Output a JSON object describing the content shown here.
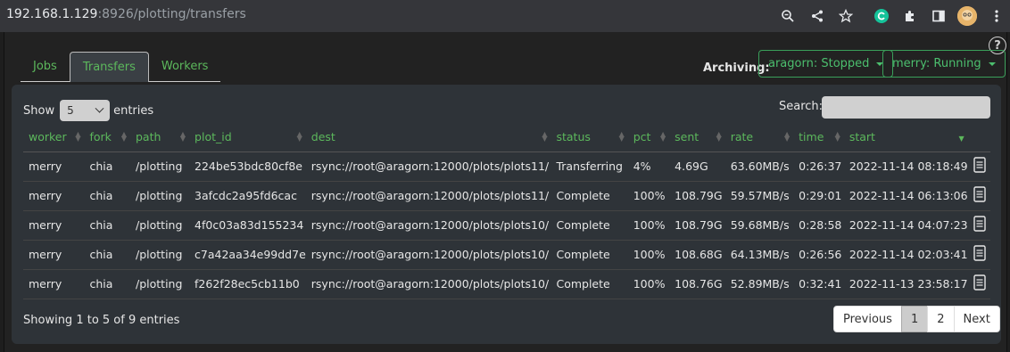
{
  "browser": {
    "url_host": "192.168.1.129",
    "url_rest": ":8926/plotting/transfers"
  },
  "tabs": [
    {
      "label": "Jobs",
      "active": false
    },
    {
      "label": "Transfers",
      "active": true
    },
    {
      "label": "Workers",
      "active": false
    }
  ],
  "archiving": {
    "label": "Archiving:",
    "buttons": [
      {
        "label": "aragorn: Stopped"
      },
      {
        "label": "merry: Running"
      }
    ]
  },
  "help_icon": "?",
  "length": {
    "show": "Show",
    "value": "5",
    "entries": "entries"
  },
  "search": {
    "label": "Search:"
  },
  "table": {
    "columns": [
      "worker",
      "fork",
      "path",
      "plot_id",
      "dest",
      "status",
      "pct",
      "sent",
      "rate",
      "time",
      "start"
    ],
    "rows": [
      [
        "merry",
        "chia",
        "/plotting",
        "224be53bdc80cf8e",
        "rsync://root@aragorn:12000/plots/plots11/",
        "Transferring",
        "4%",
        "4.69G",
        "63.60MB/s",
        "0:26:37",
        "2022-11-14 08:18:49"
      ],
      [
        "merry",
        "chia",
        "/plotting",
        "3afcdc2a95fd6cac",
        "rsync://root@aragorn:12000/plots/plots11/",
        "Complete",
        "100%",
        "108.79G",
        "59.57MB/s",
        "0:29:01",
        "2022-11-14 06:13:06"
      ],
      [
        "merry",
        "chia",
        "/plotting",
        "4f0c03a83d155234",
        "rsync://root@aragorn:12000/plots/plots10/",
        "Complete",
        "100%",
        "108.79G",
        "59.68MB/s",
        "0:28:58",
        "2022-11-14 04:07:23"
      ],
      [
        "merry",
        "chia",
        "/plotting",
        "c7a42aa34e99dd7e",
        "rsync://root@aragorn:12000/plots/plots10/",
        "Complete",
        "100%",
        "108.68G",
        "64.13MB/s",
        "0:26:56",
        "2022-11-14 02:03:41"
      ],
      [
        "merry",
        "chia",
        "/plotting",
        "f262f28ec5cb11b0",
        "rsync://root@aragorn:12000/plots/plots10/",
        "Complete",
        "100%",
        "108.76G",
        "52.89MB/s",
        "0:32:41",
        "2022-11-13 23:58:17"
      ]
    ]
  },
  "footer": {
    "info": "Showing 1 to 5 of 9 entries",
    "pagination": {
      "previous": "Previous",
      "pages": [
        "1",
        "2"
      ],
      "current": "1",
      "next": "Next"
    }
  },
  "colors": {
    "accent_green": "#5cb85c",
    "button_green": "#4cbf6e",
    "card_bg": "#2e3338"
  }
}
